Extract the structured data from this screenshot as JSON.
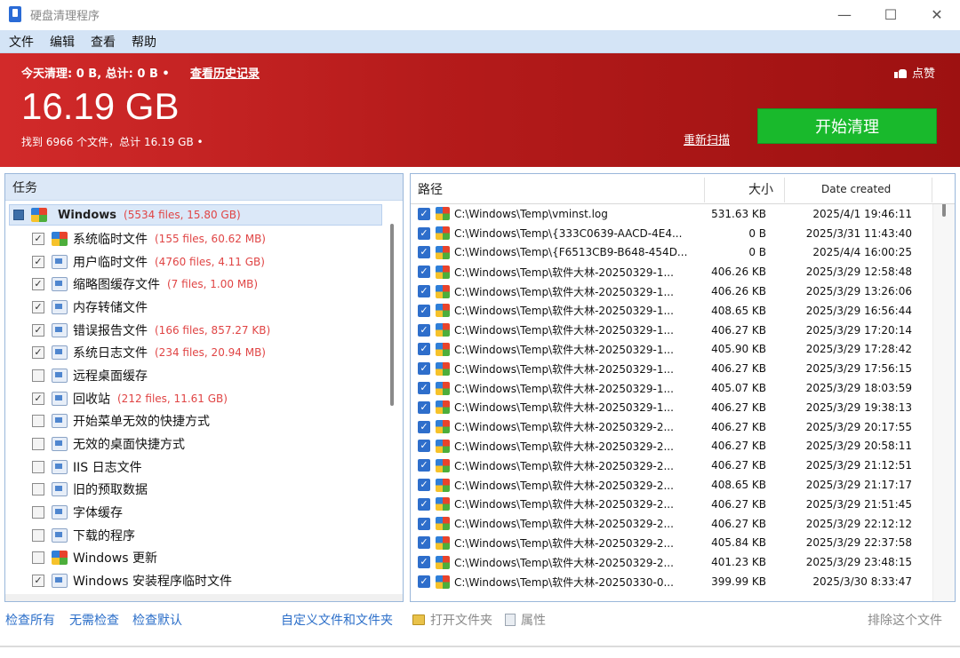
{
  "window": {
    "title": "硬盘清理程序",
    "controls": {
      "minimize": "—",
      "maximize": "☐",
      "close": "✕"
    }
  },
  "menu": [
    "文件",
    "编辑",
    "查看",
    "帮助"
  ],
  "banner": {
    "today": "今天清理: 0 B, 总计: 0 B •",
    "history_link": "查看历史记录",
    "total_size": "16.19 GB",
    "found_text": "找到 6966 个文件，总计 16.19 GB •",
    "like_label": "点赞",
    "rescan_label": "重新扫描",
    "start_label": "开始清理",
    "colors": {
      "banner": "#c0201f",
      "start_button": "#19b92c"
    }
  },
  "tasks": {
    "header": "任务",
    "root": {
      "name": "Windows",
      "stats": "(5534 files, 15.80 GB)"
    },
    "items": [
      {
        "label": "系统临时文件",
        "stats": "(155 files, 60.62 MB)",
        "checked": true,
        "icon": "windows-logo-icon"
      },
      {
        "label": "用户临时文件",
        "stats": "(4760 files, 4.11 GB)",
        "checked": true,
        "icon": "user-temp-icon"
      },
      {
        "label": "缩略图缓存文件",
        "stats": "(7 files, 1.00 MB)",
        "checked": true,
        "icon": "thumbnail-cache-icon"
      },
      {
        "label": "内存转储文件",
        "stats": "",
        "checked": true,
        "icon": "memory-dump-icon"
      },
      {
        "label": "错误报告文件",
        "stats": "(166 files, 857.27 KB)",
        "checked": true,
        "icon": "error-report-icon"
      },
      {
        "label": "系统日志文件",
        "stats": "(234 files, 20.94 MB)",
        "checked": true,
        "icon": "system-log-icon"
      },
      {
        "label": "远程桌面缓存",
        "stats": "",
        "checked": false,
        "icon": "remote-desktop-icon"
      },
      {
        "label": "回收站",
        "stats": "(212 files, 11.61 GB)",
        "checked": true,
        "icon": "recycle-bin-icon"
      },
      {
        "label": "开始菜单无效的快捷方式",
        "stats": "",
        "checked": false,
        "icon": "start-menu-shortcut-icon"
      },
      {
        "label": "无效的桌面快捷方式",
        "stats": "",
        "checked": false,
        "icon": "desktop-shortcut-icon"
      },
      {
        "label": "IIS 日志文件",
        "stats": "",
        "checked": false,
        "icon": "iis-log-icon"
      },
      {
        "label": "旧的预取数据",
        "stats": "",
        "checked": false,
        "icon": "prefetch-icon"
      },
      {
        "label": "字体缓存",
        "stats": "",
        "checked": false,
        "icon": "font-cache-icon"
      },
      {
        "label": "下载的程序",
        "stats": "",
        "checked": false,
        "icon": "downloaded-programs-icon"
      },
      {
        "label": "Windows 更新",
        "stats": "",
        "checked": false,
        "icon": "windows-update-icon"
      },
      {
        "label": "Windows 安装程序临时文件",
        "stats": "",
        "checked": true,
        "icon": "installer-temp-icon"
      }
    ]
  },
  "files": {
    "columns": {
      "path": "路径",
      "size": "大小",
      "date": "Date created"
    },
    "rows": [
      {
        "path": "C:\\Windows\\Temp\\vminst.log",
        "size": "531.63 KB",
        "date": "2025/4/1 19:46:11"
      },
      {
        "path": "C:\\Windows\\Temp\\{333C0639-AACD-4E4...",
        "size": "0 B",
        "date": "2025/3/31 11:43:40"
      },
      {
        "path": "C:\\Windows\\Temp\\{F6513CB9-B648-454D...",
        "size": "0 B",
        "date": "2025/4/4 16:00:25"
      },
      {
        "path": "C:\\Windows\\Temp\\软件大林-20250329-1...",
        "size": "406.26 KB",
        "date": "2025/3/29 12:58:48"
      },
      {
        "path": "C:\\Windows\\Temp\\软件大林-20250329-1...",
        "size": "406.26 KB",
        "date": "2025/3/29 13:26:06"
      },
      {
        "path": "C:\\Windows\\Temp\\软件大林-20250329-1...",
        "size": "408.65 KB",
        "date": "2025/3/29 16:56:44"
      },
      {
        "path": "C:\\Windows\\Temp\\软件大林-20250329-1...",
        "size": "406.27 KB",
        "date": "2025/3/29 17:20:14"
      },
      {
        "path": "C:\\Windows\\Temp\\软件大林-20250329-1...",
        "size": "405.90 KB",
        "date": "2025/3/29 17:28:42"
      },
      {
        "path": "C:\\Windows\\Temp\\软件大林-20250329-1...",
        "size": "406.27 KB",
        "date": "2025/3/29 17:56:15"
      },
      {
        "path": "C:\\Windows\\Temp\\软件大林-20250329-1...",
        "size": "405.07 KB",
        "date": "2025/3/29 18:03:59"
      },
      {
        "path": "C:\\Windows\\Temp\\软件大林-20250329-1...",
        "size": "406.27 KB",
        "date": "2025/3/29 19:38:13"
      },
      {
        "path": "C:\\Windows\\Temp\\软件大林-20250329-2...",
        "size": "406.27 KB",
        "date": "2025/3/29 20:17:55"
      },
      {
        "path": "C:\\Windows\\Temp\\软件大林-20250329-2...",
        "size": "406.27 KB",
        "date": "2025/3/29 20:58:11"
      },
      {
        "path": "C:\\Windows\\Temp\\软件大林-20250329-2...",
        "size": "406.27 KB",
        "date": "2025/3/29 21:12:51"
      },
      {
        "path": "C:\\Windows\\Temp\\软件大林-20250329-2...",
        "size": "408.65 KB",
        "date": "2025/3/29 21:17:17"
      },
      {
        "path": "C:\\Windows\\Temp\\软件大林-20250329-2...",
        "size": "406.27 KB",
        "date": "2025/3/29 21:51:45"
      },
      {
        "path": "C:\\Windows\\Temp\\软件大林-20250329-2...",
        "size": "406.27 KB",
        "date": "2025/3/29 22:12:12"
      },
      {
        "path": "C:\\Windows\\Temp\\软件大林-20250329-2...",
        "size": "405.84 KB",
        "date": "2025/3/29 22:37:58"
      },
      {
        "path": "C:\\Windows\\Temp\\软件大林-20250329-2...",
        "size": "401.23 KB",
        "date": "2025/3/29 23:48:15"
      },
      {
        "path": "C:\\Windows\\Temp\\软件大林-20250330-0...",
        "size": "399.99 KB",
        "date": "2025/3/30 8:33:47"
      }
    ]
  },
  "bottom": {
    "check_all": "检查所有",
    "no_check": "无需检查",
    "check_default": "检查默认",
    "custom": "自定义文件和文件夹",
    "open_folder": "打开文件夹",
    "properties": "属性",
    "exclude": "排除这个文件"
  }
}
